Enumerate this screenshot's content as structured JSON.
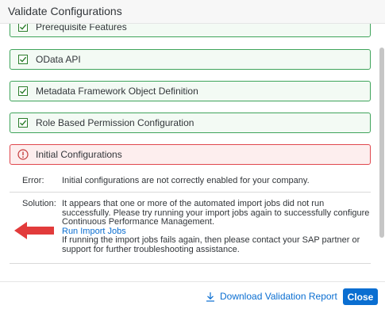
{
  "dialog": {
    "title": "Validate Configurations"
  },
  "checks": [
    {
      "label": "Prerequisite Features",
      "status": "passed"
    },
    {
      "label": "OData API",
      "status": "passed"
    },
    {
      "label": "Metadata Framework Object Definition",
      "status": "passed"
    },
    {
      "label": "Role Based Permission Configuration",
      "status": "passed"
    },
    {
      "label": "Initial Configurations",
      "status": "failed"
    }
  ],
  "details": {
    "error_key": "Error:",
    "error_text": "Initial configurations are not correctly enabled for your company.",
    "solution_key": "Solution:",
    "solution_text": "It appears that one or more of the automated import jobs did not run successfully. Please try running your import jobs again to successfully configure Continuous Performance Management.",
    "solution_link": "Run Import Jobs",
    "solution_followup": "If running the import jobs fails again, then please contact your SAP partner or support for further troubleshooting assistance."
  },
  "footer": {
    "download_label": "Download Validation Report",
    "close_label": "Close"
  },
  "colors": {
    "success_border": "#3fa45b",
    "error_border": "#e0474e",
    "link": "#0a6ed1",
    "annotation_arrow": "#e23b3b"
  },
  "icons": {
    "check": "checkbox-checked-icon",
    "error": "error-circle-icon",
    "download": "download-icon",
    "annotation": "red-arrow-icon"
  }
}
